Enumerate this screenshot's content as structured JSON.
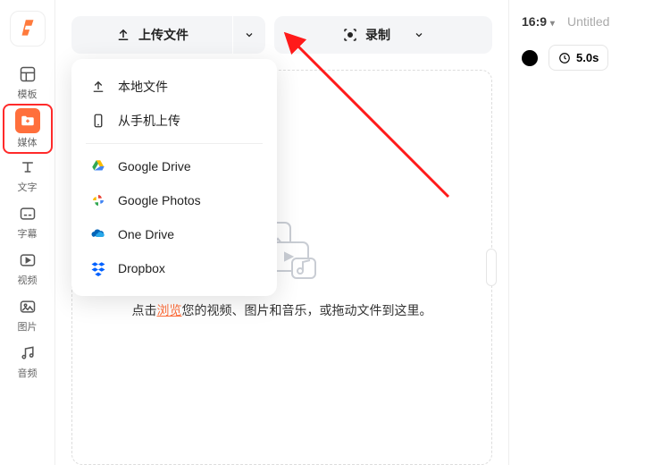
{
  "sidebar": {
    "logo": "F",
    "items": [
      {
        "id": "templates",
        "icon": "layout",
        "label": "模板"
      },
      {
        "id": "media",
        "icon": "folder-plus",
        "label": "媒体",
        "active": true
      },
      {
        "id": "text",
        "icon": "text",
        "label": "文字"
      },
      {
        "id": "subtitle",
        "icon": "subtitle",
        "label": "字幕"
      },
      {
        "id": "video",
        "icon": "play",
        "label": "视频"
      },
      {
        "id": "image",
        "icon": "image",
        "label": "图片"
      },
      {
        "id": "audio",
        "icon": "music",
        "label": "音频"
      }
    ]
  },
  "toolbar": {
    "upload_label": "上传文件",
    "record_label": "录制"
  },
  "upload_menu": {
    "local": "本地文件",
    "phone": "从手机上传",
    "cloud": [
      {
        "id": "gdrive",
        "label": "Google Drive"
      },
      {
        "id": "gphotos",
        "label": "Google Photos"
      },
      {
        "id": "onedrive",
        "label": "One Drive"
      },
      {
        "id": "dropbox",
        "label": "Dropbox"
      }
    ]
  },
  "dropzone": {
    "prefix": "点击",
    "browse": "浏览",
    "mid": "您的视频、图片和音乐，或拖动文件到这里。"
  },
  "right": {
    "aspect": "16:9",
    "title": "Untitled",
    "duration": "5.0s"
  }
}
